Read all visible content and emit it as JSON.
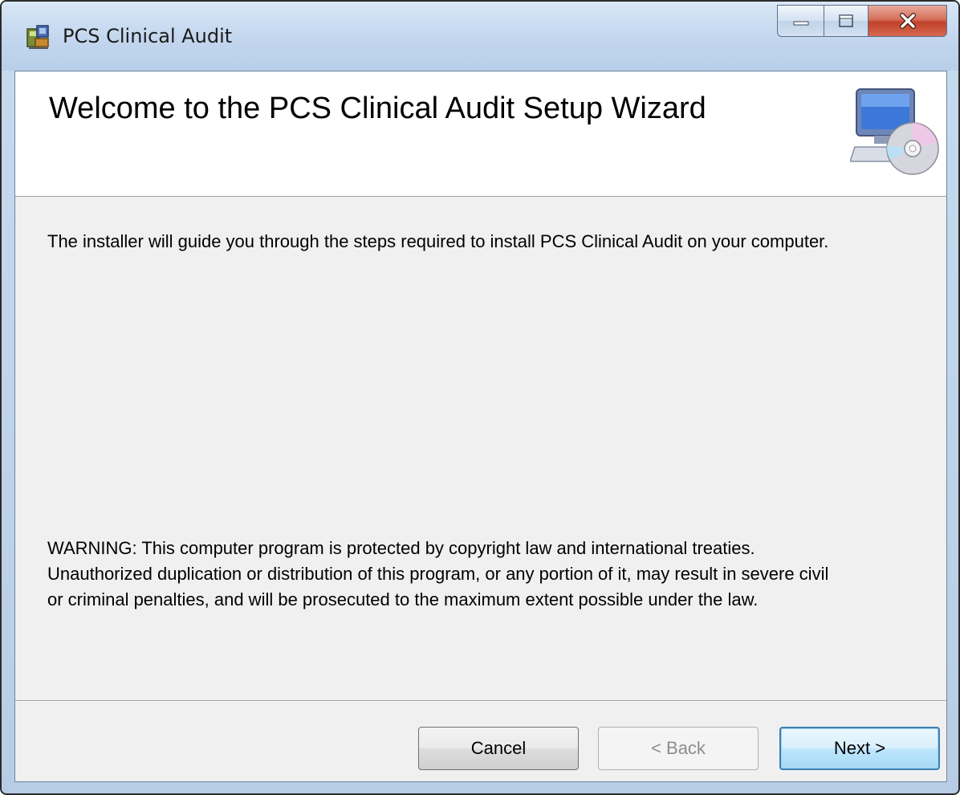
{
  "window": {
    "title": "PCS Clinical Audit",
    "controls": [
      "minimize",
      "maximize",
      "close"
    ]
  },
  "banner": {
    "title": "Welcome to the PCS Clinical Audit Setup Wizard",
    "icon": "computer-with-disc-icon"
  },
  "body": {
    "intro": "The installer will guide you through the steps required to install PCS Clinical Audit on your computer.",
    "warning_lines": [
      "WARNING: This computer program is protected by copyright law and international treaties.",
      "Unauthorized duplication or distribution of this program, or any portion of it, may result in severe civil",
      "or criminal penalties, and will be prosecuted to the maximum extent possible under the law."
    ]
  },
  "buttons": {
    "cancel": "Cancel",
    "back": "< Back",
    "next": "Next >"
  },
  "colors": {
    "client_background": "#f0f0f0",
    "banner_background": "#ffffff",
    "close_button": "#c1412a",
    "default_button_border": "#3c7fb1"
  }
}
